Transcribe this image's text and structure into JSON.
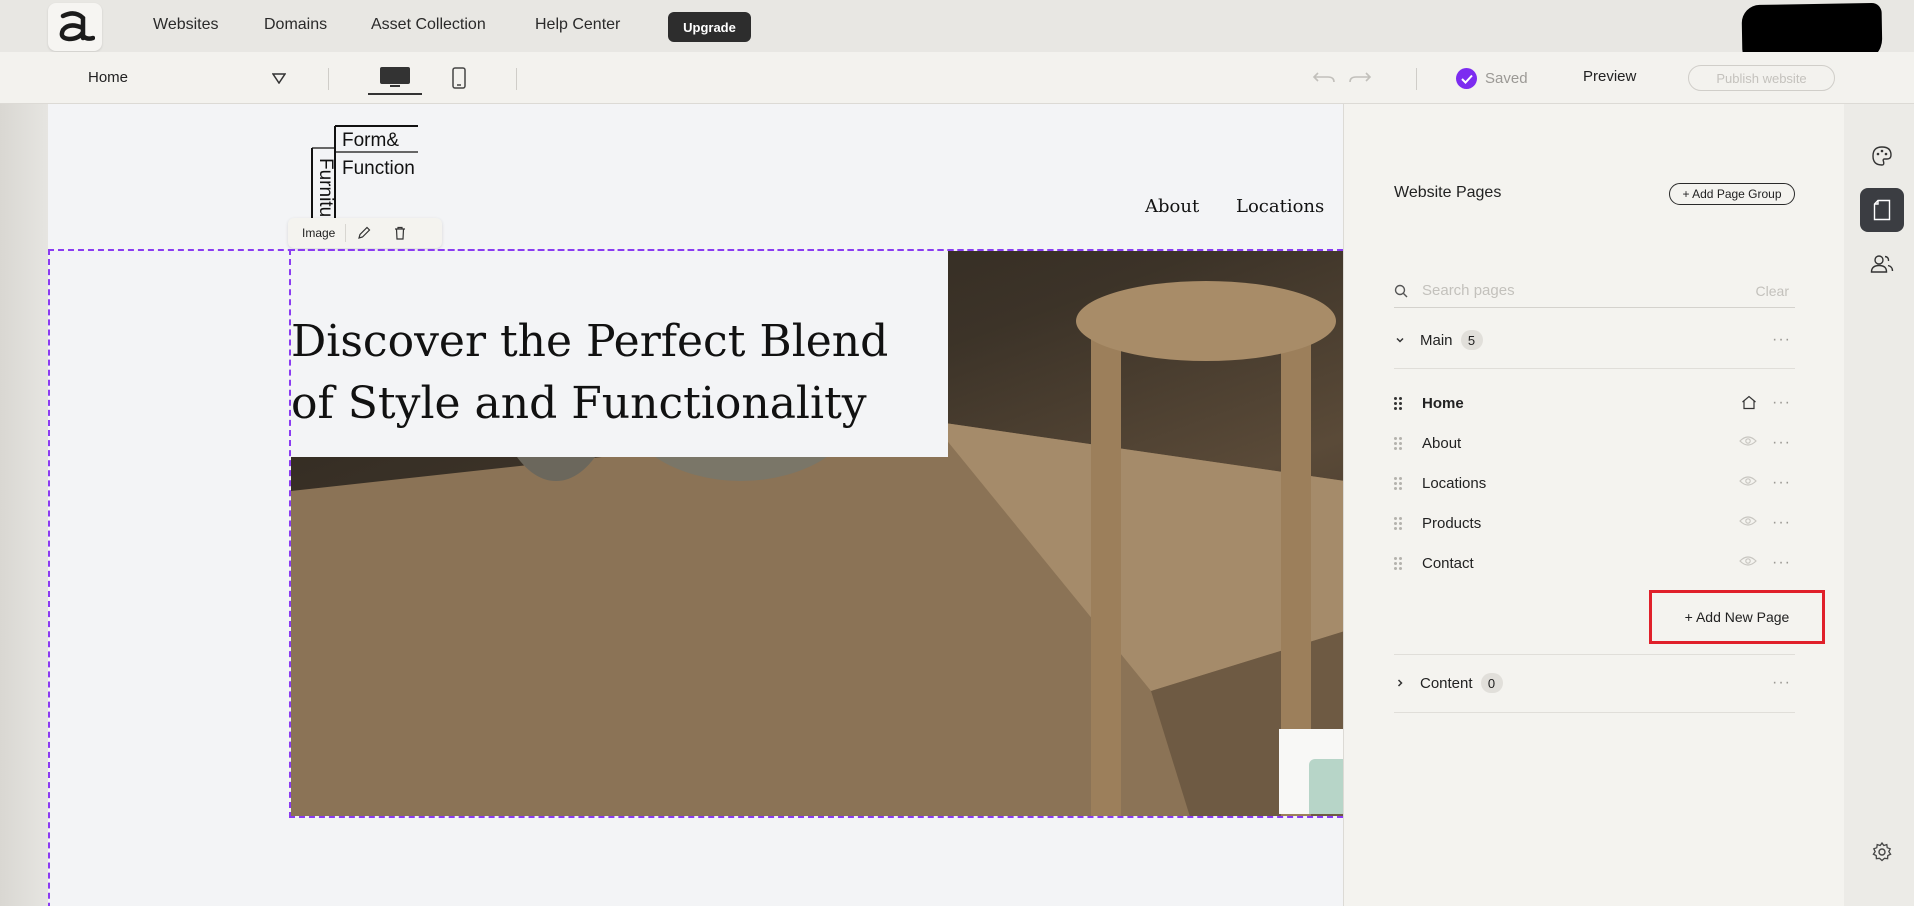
{
  "topnav": {
    "links": [
      "Websites",
      "Domains",
      "Asset Collection",
      "Help Center"
    ],
    "upgrade_label": "Upgrade"
  },
  "toolbar": {
    "current_page": "Home",
    "saved_label": "Saved",
    "preview_label": "Preview",
    "publish_label": "Publish website"
  },
  "canvas": {
    "logo_line1": "Form&",
    "logo_line2": "Function",
    "logo_vertical": "Furnitu",
    "nav": [
      "About",
      "Locations"
    ],
    "image_toolbar_label": "Image",
    "hero_heading": "Discover the Perfect Blend of Style and Functionality"
  },
  "panel": {
    "title": "Website Pages",
    "add_group_label": "+ Add Page Group",
    "search_placeholder": "Search pages",
    "clear_label": "Clear",
    "groups": [
      {
        "name": "Main",
        "count": "5"
      },
      {
        "name": "Content",
        "count": "0"
      }
    ],
    "pages": [
      "Home",
      "About",
      "Locations",
      "Products",
      "Contact"
    ],
    "add_page_label": "+ Add New Page"
  },
  "colors": {
    "accent_purple": "#7c2cf0",
    "highlight_red": "#e0202a"
  }
}
